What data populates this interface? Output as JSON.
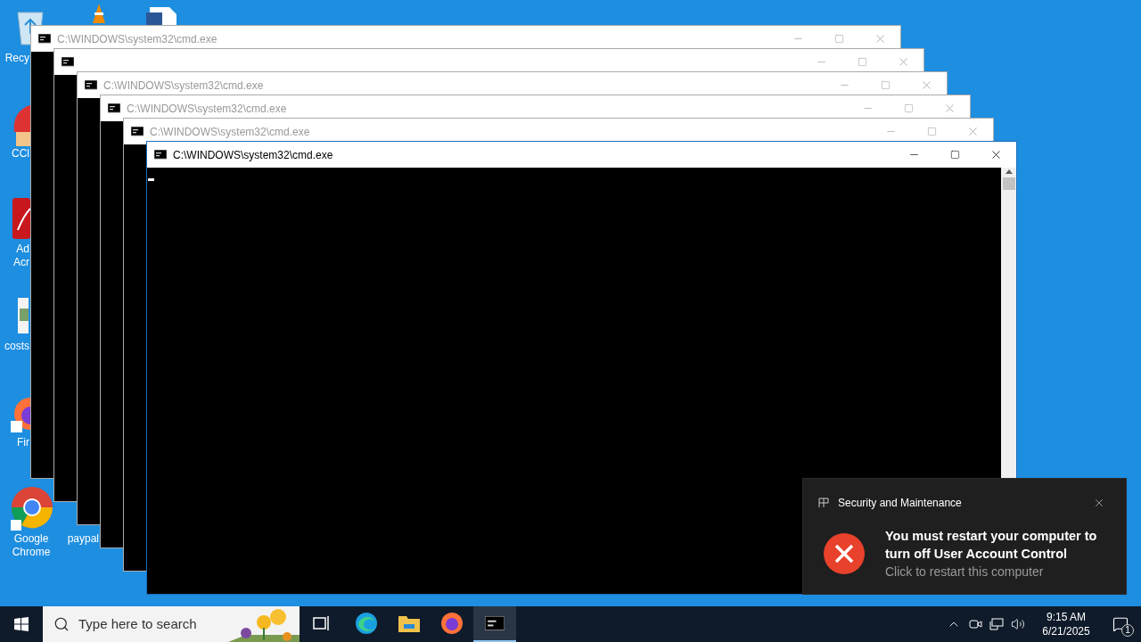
{
  "desktop_icons": [
    {
      "kind": "recycle",
      "lines": [
        "Recy"
      ]
    },
    {
      "kind": "cone"
    },
    {
      "kind": "document"
    },
    {
      "kind": "cleaner",
      "lines": [
        "CCl"
      ]
    },
    {
      "kind": "acrobat",
      "lines": [
        "Ad",
        "Acr"
      ]
    },
    {
      "kind": "image",
      "lines": [
        "costs"
      ]
    },
    {
      "kind": "firefox",
      "lines": [
        "Fir"
      ]
    },
    {
      "kind": "chrome",
      "lines": [
        "Google",
        "Chrome"
      ]
    },
    {
      "kind": "blank",
      "lines": [
        "paypal"
      ]
    }
  ],
  "windows": [
    {
      "title": "C:\\WINDOWS\\system32\\cmd.exe",
      "active": false
    },
    {
      "active": false
    },
    {
      "title": "C:\\WINDOWS\\system32\\cmd.exe",
      "active": false
    },
    {
      "title": "C:\\WINDOWS\\system32\\cmd.exe",
      "active": false
    },
    {
      "title": "C:\\WINDOWS\\system32\\cmd.exe",
      "active": false
    },
    {
      "title": "C:\\WINDOWS\\system32\\cmd.exe",
      "active": true
    }
  ],
  "toast": {
    "source": "Security and Maintenance",
    "heading": "You must restart your computer to turn off User Account Control",
    "body": "Click to restart this computer"
  },
  "taskbar": {
    "search_placeholder": "Type here to search",
    "apps": [
      {
        "kind": "taskview",
        "selected": false
      },
      {
        "kind": "edge",
        "selected": false
      },
      {
        "kind": "explorer",
        "selected": false
      },
      {
        "kind": "firefox",
        "selected": false
      },
      {
        "kind": "cmd",
        "selected": true
      }
    ],
    "time": "9:15 AM",
    "date": "6/21/2025",
    "notification_count": "1"
  }
}
